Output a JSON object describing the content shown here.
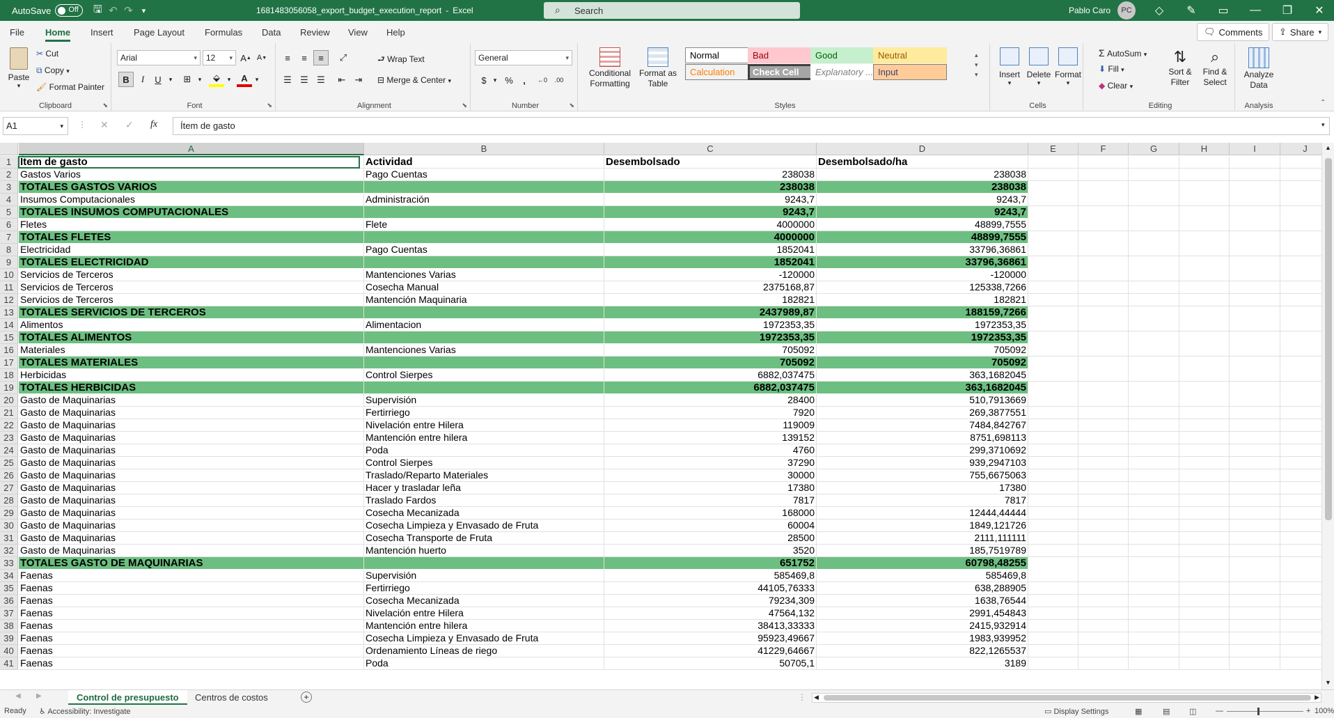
{
  "titlebar": {
    "autosave_label": "AutoSave",
    "autosave_state": "Off",
    "filename": "1681483056058_export_budget_execution_report",
    "app": "Excel",
    "separator": "-",
    "search_placeholder": "Search",
    "user_name": "Pablo Caro",
    "user_initials": "PC"
  },
  "ribbon_tabs": [
    "File",
    "Home",
    "Insert",
    "Page Layout",
    "Formulas",
    "Data",
    "Review",
    "View",
    "Help"
  ],
  "active_tab": "Home",
  "comments_label": "Comments",
  "share_label": "Share",
  "ribbon": {
    "clipboard": {
      "paste": "Paste",
      "cut": "Cut",
      "copy": "Copy",
      "format_painter": "Format Painter",
      "label": "Clipboard"
    },
    "font": {
      "name": "Arial",
      "size": "12",
      "label": "Font"
    },
    "alignment": {
      "wrap_text": "Wrap Text",
      "merge_center": "Merge & Center",
      "label": "Alignment"
    },
    "number": {
      "format": "General",
      "label": "Number"
    },
    "styles": {
      "conditional_formatting": "Conditional Formatting",
      "format_as_table": "Format as Table",
      "cells": [
        {
          "name": "Normal",
          "bg": "#ffffff",
          "fg": "#000000",
          "border": "#888888"
        },
        {
          "name": "Bad",
          "bg": "#ffc7ce",
          "fg": "#9c0006",
          "border": "#ffc7ce"
        },
        {
          "name": "Good",
          "bg": "#c6efce",
          "fg": "#006100",
          "border": "#c6efce"
        },
        {
          "name": "Neutral",
          "bg": "#ffeb9c",
          "fg": "#9c5700",
          "border": "#ffeb9c"
        },
        {
          "name": "Calculation",
          "bg": "#f2f2f2",
          "fg": "#fa7d00",
          "border": "#7f7f7f"
        },
        {
          "name": "Check Cell",
          "bg": "#a5a5a5",
          "fg": "#ffffff",
          "border": "#3f3f3f"
        },
        {
          "name": "Explanatory ...",
          "bg": "#ffffff",
          "fg": "#7f7f7f",
          "border": "#ffffff"
        },
        {
          "name": "Input",
          "bg": "#ffcc99",
          "fg": "#3f3f76",
          "border": "#7f7f7f"
        }
      ],
      "label": "Styles"
    },
    "cells": {
      "insert": "Insert",
      "delete": "Delete",
      "format": "Format",
      "label": "Cells"
    },
    "editing": {
      "autosum": "AutoSum",
      "fill": "Fill",
      "clear": "Clear",
      "sort_filter": "Sort & Filter",
      "find_select": "Find & Select",
      "label": "Editing"
    },
    "analysis": {
      "analyze_data": "Analyze Data",
      "label": "Analysis"
    }
  },
  "formula_bar": {
    "name_box": "A1",
    "fx": "fx",
    "content": "Ítem de gasto"
  },
  "columns": [
    {
      "letter": "A",
      "w": 496
    },
    {
      "letter": "B",
      "w": 345
    },
    {
      "letter": "C",
      "w": 305
    },
    {
      "letter": "D",
      "w": 304
    },
    {
      "letter": "E",
      "w": 72
    },
    {
      "letter": "F",
      "w": 72
    },
    {
      "letter": "G",
      "w": 73
    },
    {
      "letter": "H",
      "w": 72
    },
    {
      "letter": "I",
      "w": 73
    },
    {
      "letter": "J",
      "w": 72
    }
  ],
  "rows": [
    {
      "n": "1",
      "type": "header",
      "a": "Ítem de gasto",
      "b": "Actividad",
      "c": "Desembolsado",
      "d": "Desembolsado/ha"
    },
    {
      "n": "2",
      "a": "Gastos Varios",
      "b": "Pago Cuentas",
      "c": "238038",
      "d": "238038"
    },
    {
      "n": "3",
      "type": "total",
      "a": "TOTALES GASTOS VARIOS",
      "b": "",
      "c": "238038",
      "d": "238038"
    },
    {
      "n": "4",
      "a": "Insumos Computacionales",
      "b": "Administración",
      "c": "9243,7",
      "d": "9243,7"
    },
    {
      "n": "5",
      "type": "total",
      "a": "TOTALES INSUMOS COMPUTACIONALES",
      "b": "",
      "c": "9243,7",
      "d": "9243,7"
    },
    {
      "n": "6",
      "a": "Fletes",
      "b": "Flete",
      "c": "4000000",
      "d": "48899,7555"
    },
    {
      "n": "7",
      "type": "total",
      "a": "TOTALES FLETES",
      "b": "",
      "c": "4000000",
      "d": "48899,7555"
    },
    {
      "n": "8",
      "a": "Electricidad",
      "b": "Pago Cuentas",
      "c": "1852041",
      "d": "33796,36861"
    },
    {
      "n": "9",
      "type": "total",
      "a": "TOTALES ELECTRICIDAD",
      "b": "",
      "c": "1852041",
      "d": "33796,36861"
    },
    {
      "n": "10",
      "a": "Servicios de Terceros",
      "b": "Mantenciones Varias",
      "c": "-120000",
      "d": "-120000"
    },
    {
      "n": "11",
      "a": "Servicios de Terceros",
      "b": "Cosecha Manual",
      "c": "2375168,87",
      "d": "125338,7266"
    },
    {
      "n": "12",
      "a": "Servicios de Terceros",
      "b": "Mantención Maquinaria",
      "c": "182821",
      "d": "182821"
    },
    {
      "n": "13",
      "type": "total",
      "a": "TOTALES SERVICIOS DE TERCEROS",
      "b": "",
      "c": "2437989,87",
      "d": "188159,7266"
    },
    {
      "n": "14",
      "a": "Alimentos",
      "b": "Alimentacion",
      "c": "1972353,35",
      "d": "1972353,35"
    },
    {
      "n": "15",
      "type": "total",
      "a": "TOTALES ALIMENTOS",
      "b": "",
      "c": "1972353,35",
      "d": "1972353,35"
    },
    {
      "n": "16",
      "a": "Materiales",
      "b": "Mantenciones Varias",
      "c": "705092",
      "d": "705092"
    },
    {
      "n": "17",
      "type": "total",
      "a": "TOTALES MATERIALES",
      "b": "",
      "c": "705092",
      "d": "705092"
    },
    {
      "n": "18",
      "a": "Herbicidas",
      "b": "Control Sierpes",
      "c": "6882,037475",
      "d": "363,1682045"
    },
    {
      "n": "19",
      "type": "total",
      "a": "TOTALES HERBICIDAS",
      "b": "",
      "c": "6882,037475",
      "d": "363,1682045"
    },
    {
      "n": "20",
      "a": "Gasto de Maquinarias",
      "b": "Supervisión",
      "c": "28400",
      "d": "510,7913669"
    },
    {
      "n": "21",
      "a": "Gasto de Maquinarias",
      "b": "Fertirriego",
      "c": "7920",
      "d": "269,3877551"
    },
    {
      "n": "22",
      "a": "Gasto de Maquinarias",
      "b": "Nivelación entre Hilera",
      "c": "119009",
      "d": "7484,842767"
    },
    {
      "n": "23",
      "a": "Gasto de Maquinarias",
      "b": "Mantención entre hilera",
      "c": "139152",
      "d": "8751,698113"
    },
    {
      "n": "24",
      "a": "Gasto de Maquinarias",
      "b": "Poda",
      "c": "4760",
      "d": "299,3710692"
    },
    {
      "n": "25",
      "a": "Gasto de Maquinarias",
      "b": "Control Sierpes",
      "c": "37290",
      "d": "939,2947103"
    },
    {
      "n": "26",
      "a": "Gasto de Maquinarias",
      "b": "Traslado/Reparto Materiales",
      "c": "30000",
      "d": "755,6675063"
    },
    {
      "n": "27",
      "a": "Gasto de Maquinarias",
      "b": "Hacer y trasladar leña",
      "c": "17380",
      "d": "17380"
    },
    {
      "n": "28",
      "a": "Gasto de Maquinarias",
      "b": "Traslado Fardos",
      "c": "7817",
      "d": "7817"
    },
    {
      "n": "29",
      "a": "Gasto de Maquinarias",
      "b": "Cosecha Mecanizada",
      "c": "168000",
      "d": "12444,44444"
    },
    {
      "n": "30",
      "a": "Gasto de Maquinarias",
      "b": "Cosecha Limpieza y Envasado de Fruta",
      "c": "60004",
      "d": "1849,121726"
    },
    {
      "n": "31",
      "a": "Gasto de Maquinarias",
      "b": "Cosecha Transporte de Fruta",
      "c": "28500",
      "d": "2111,111111"
    },
    {
      "n": "32",
      "a": "Gasto de Maquinarias",
      "b": "Mantención huerto",
      "c": "3520",
      "d": "185,7519789"
    },
    {
      "n": "33",
      "type": "total",
      "a": "TOTALES GASTO DE MAQUINARIAS",
      "b": "",
      "c": "651752",
      "d": "60798,48255"
    },
    {
      "n": "34",
      "a": "Faenas",
      "b": "Supervisión",
      "c": "585469,8",
      "d": "585469,8"
    },
    {
      "n": "35",
      "a": "Faenas",
      "b": "Fertirriego",
      "c": "44105,76333",
      "d": "638,288905"
    },
    {
      "n": "36",
      "a": "Faenas",
      "b": "Cosecha Mecanizada",
      "c": "79234,309",
      "d": "1638,76544"
    },
    {
      "n": "37",
      "a": "Faenas",
      "b": "Nivelación entre Hilera",
      "c": "47564,132",
      "d": "2991,454843"
    },
    {
      "n": "38",
      "a": "Faenas",
      "b": "Mantención entre hilera",
      "c": "38413,33333",
      "d": "2415,932914"
    },
    {
      "n": "39",
      "a": "Faenas",
      "b": "Cosecha Limpieza y Envasado de Fruta",
      "c": "95923,49667",
      "d": "1983,939952"
    },
    {
      "n": "40",
      "a": "Faenas",
      "b": "Ordenamiento Líneas de riego",
      "c": "41229,64667",
      "d": "822,1265537"
    },
    {
      "n": "41",
      "a": "Faenas",
      "b": "Poda",
      "c": "50705,1",
      "d": "3189"
    }
  ],
  "sheet_tabs": [
    "Control de presupuesto",
    "Centros de costos"
  ],
  "active_sheet": "Control de presupuesto",
  "statusbar": {
    "ready": "Ready",
    "accessibility": "Accessibility: Investigate",
    "display_settings": "Display Settings",
    "zoom": "100%"
  }
}
